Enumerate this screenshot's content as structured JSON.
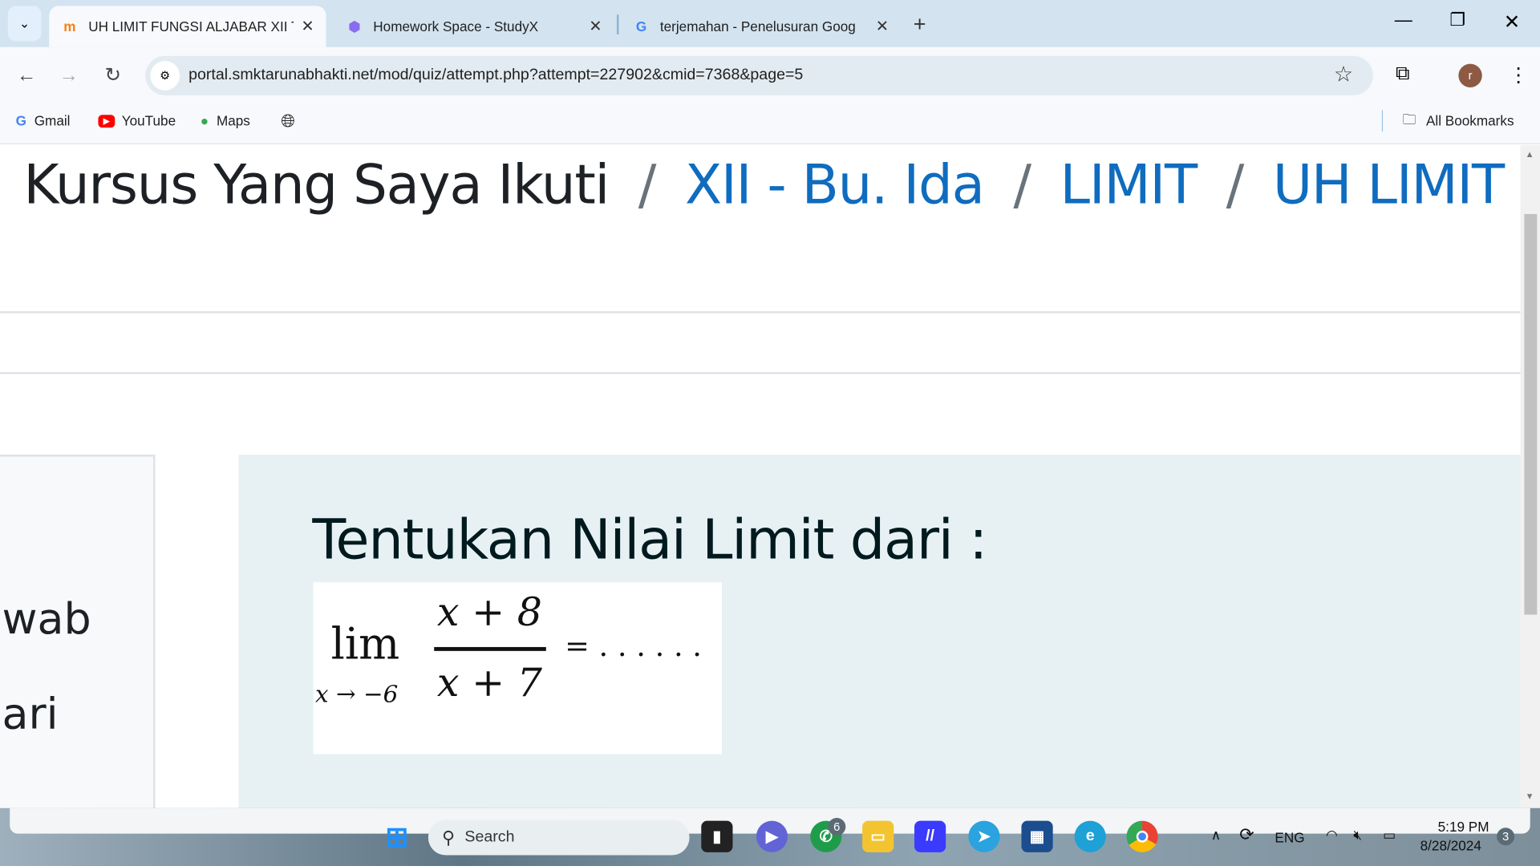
{
  "browser": {
    "tabs": [
      {
        "title": "UH LIMIT FUNGSI ALJABAR XII T",
        "icon": "moodle-icon",
        "active": true
      },
      {
        "title": "Homework Space - StudyX",
        "icon": "studyx-icon",
        "active": false
      },
      {
        "title": "terjemahan - Penelusuran Goog",
        "icon": "google-icon",
        "active": false
      }
    ],
    "url": "portal.smktarunabhakti.net/mod/quiz/attempt.php?attempt=227902&cmid=7368&page=5",
    "profile_initial": "r",
    "bookmarks": [
      "Gmail",
      "YouTube",
      "Maps"
    ],
    "all_bookmarks": "All Bookmarks"
  },
  "page": {
    "breadcrumb": [
      {
        "label": "Kursus Yang Saya Ikuti",
        "link": false
      },
      {
        "label": "XII - Bu. Ida",
        "link": true
      },
      {
        "label": "LIMIT",
        "link": true
      },
      {
        "label": "UH LIMIT FU",
        "link": true
      }
    ],
    "breadcrumb_sep": "/",
    "left_panel": {
      "line1": "wab",
      "line2": "ari"
    },
    "question": {
      "text": "Tentukan Nilai Limit dari :",
      "formula": {
        "lim": "lim",
        "sub": "x → −6",
        "numerator": "x + 8",
        "denominator": "x + 7",
        "tail": "= . . . . . ."
      }
    }
  },
  "taskbar": {
    "search_placeholder": "Search",
    "whatsapp_badge": "6",
    "language": "ENG",
    "time": "5:19 PM",
    "date": "8/28/2024",
    "notification_count": "3"
  }
}
